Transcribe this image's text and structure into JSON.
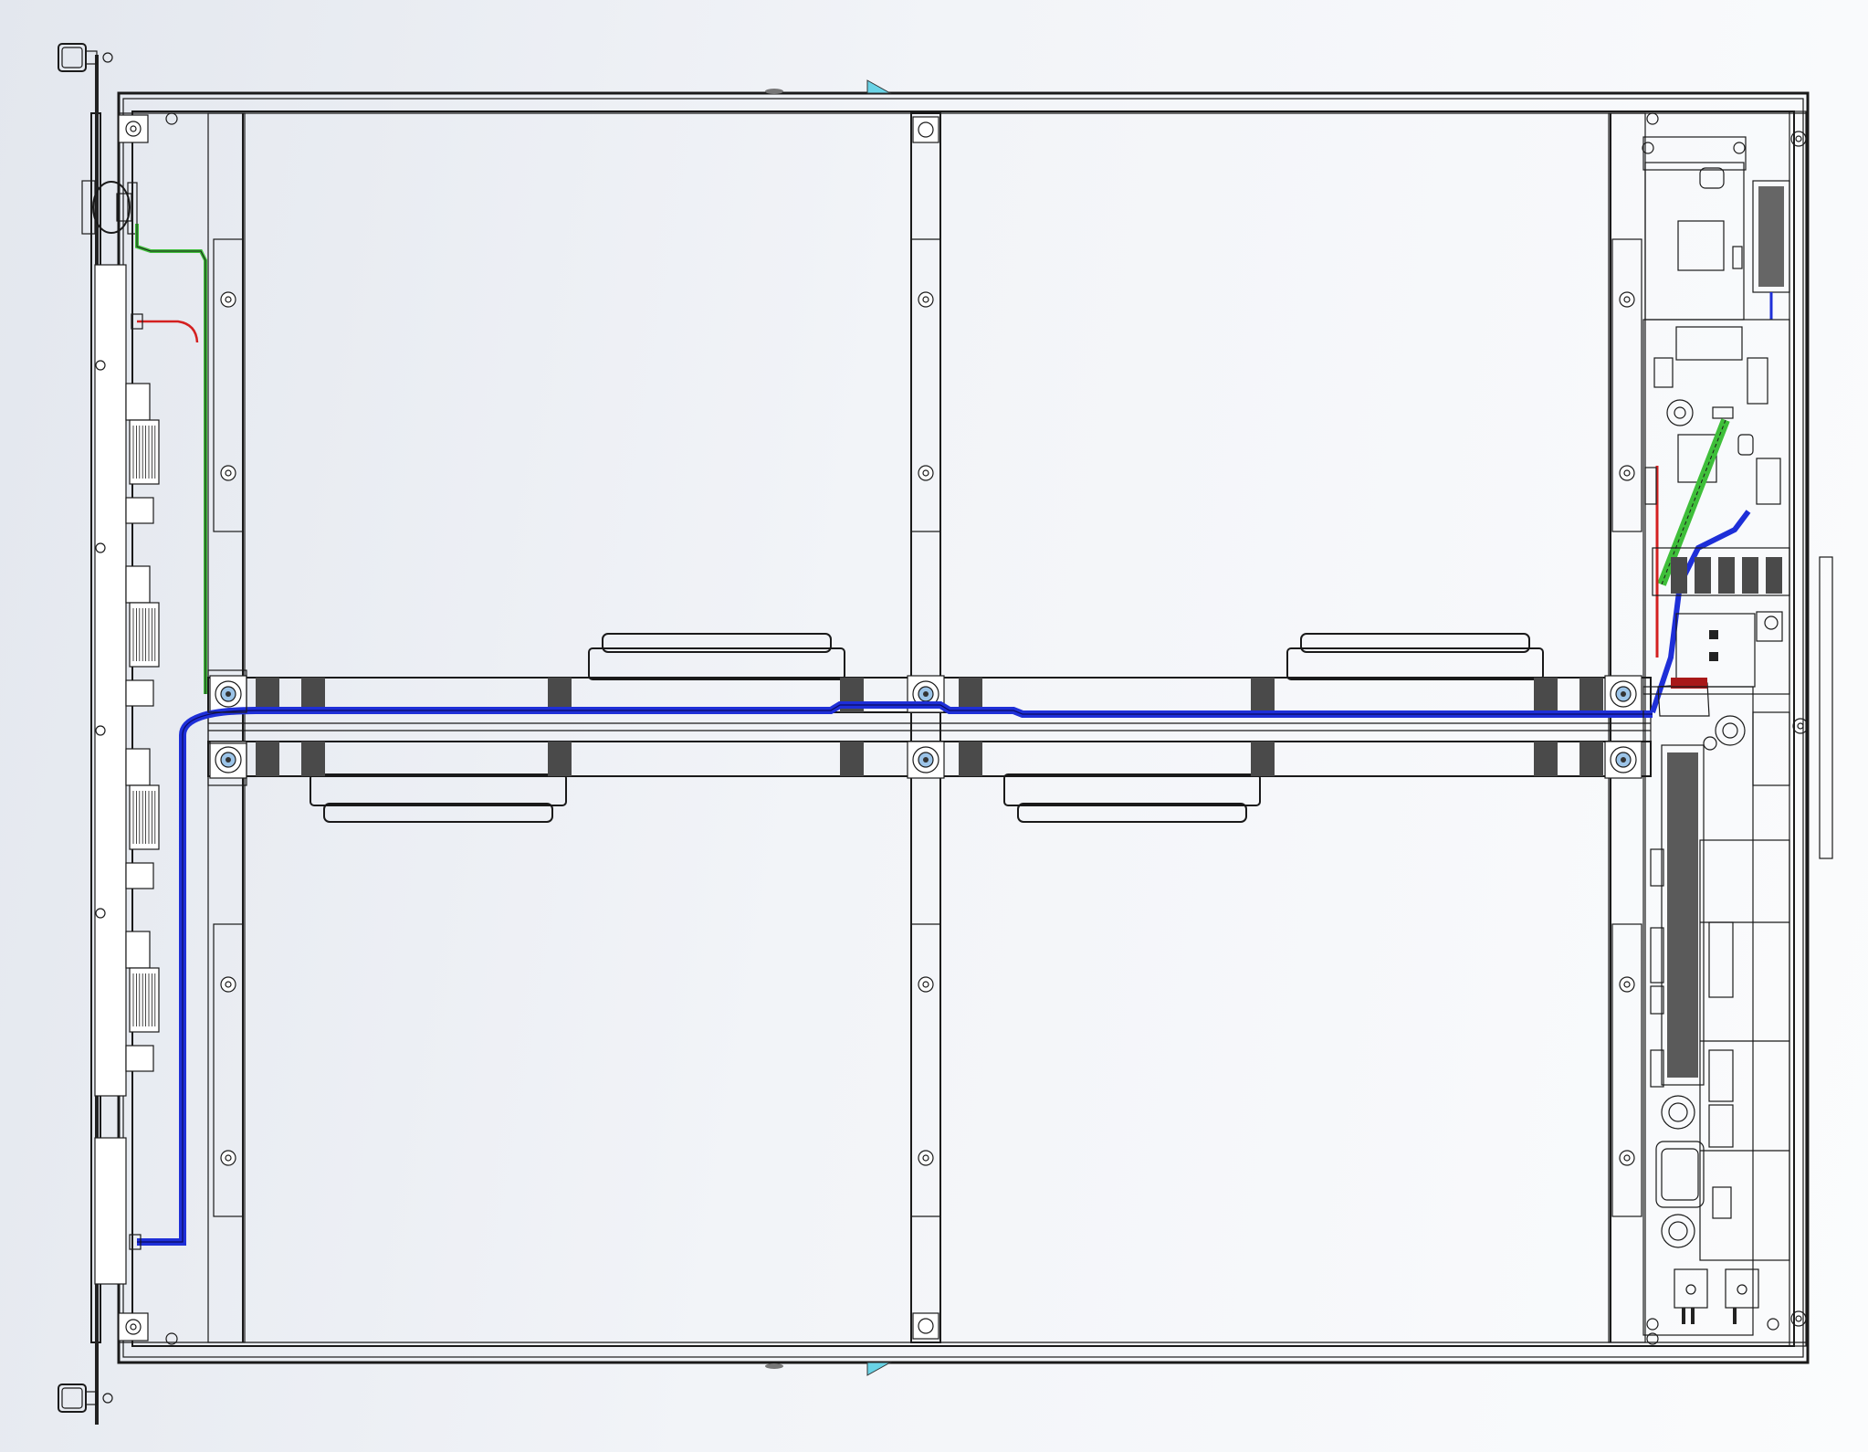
{
  "view": {
    "type": "CAD top view of rack chassis assembly",
    "colors": {
      "background": "#eef1f5",
      "chassis_fill": "#ffffff",
      "outline": "#1a1a1a",
      "pcb_green": "#44c83a",
      "pcb_dark": "#2e8a28",
      "cable_blue": "#1e2fd8",
      "cable_red": "#d42020",
      "cable_green": "#3fbf3a",
      "copper_busbar": "#e8a488",
      "bearing_blue": "#9cc4e8",
      "steel_gray": "#4a4a4a",
      "accent_cyan": "#69d3e6"
    },
    "front_panel": {
      "connector_groups": 4,
      "thumbscrews": 2
    },
    "bays": {
      "rows": 2,
      "columns": 2
    },
    "fan_rails": 1,
    "pcb_boards": 2
  }
}
